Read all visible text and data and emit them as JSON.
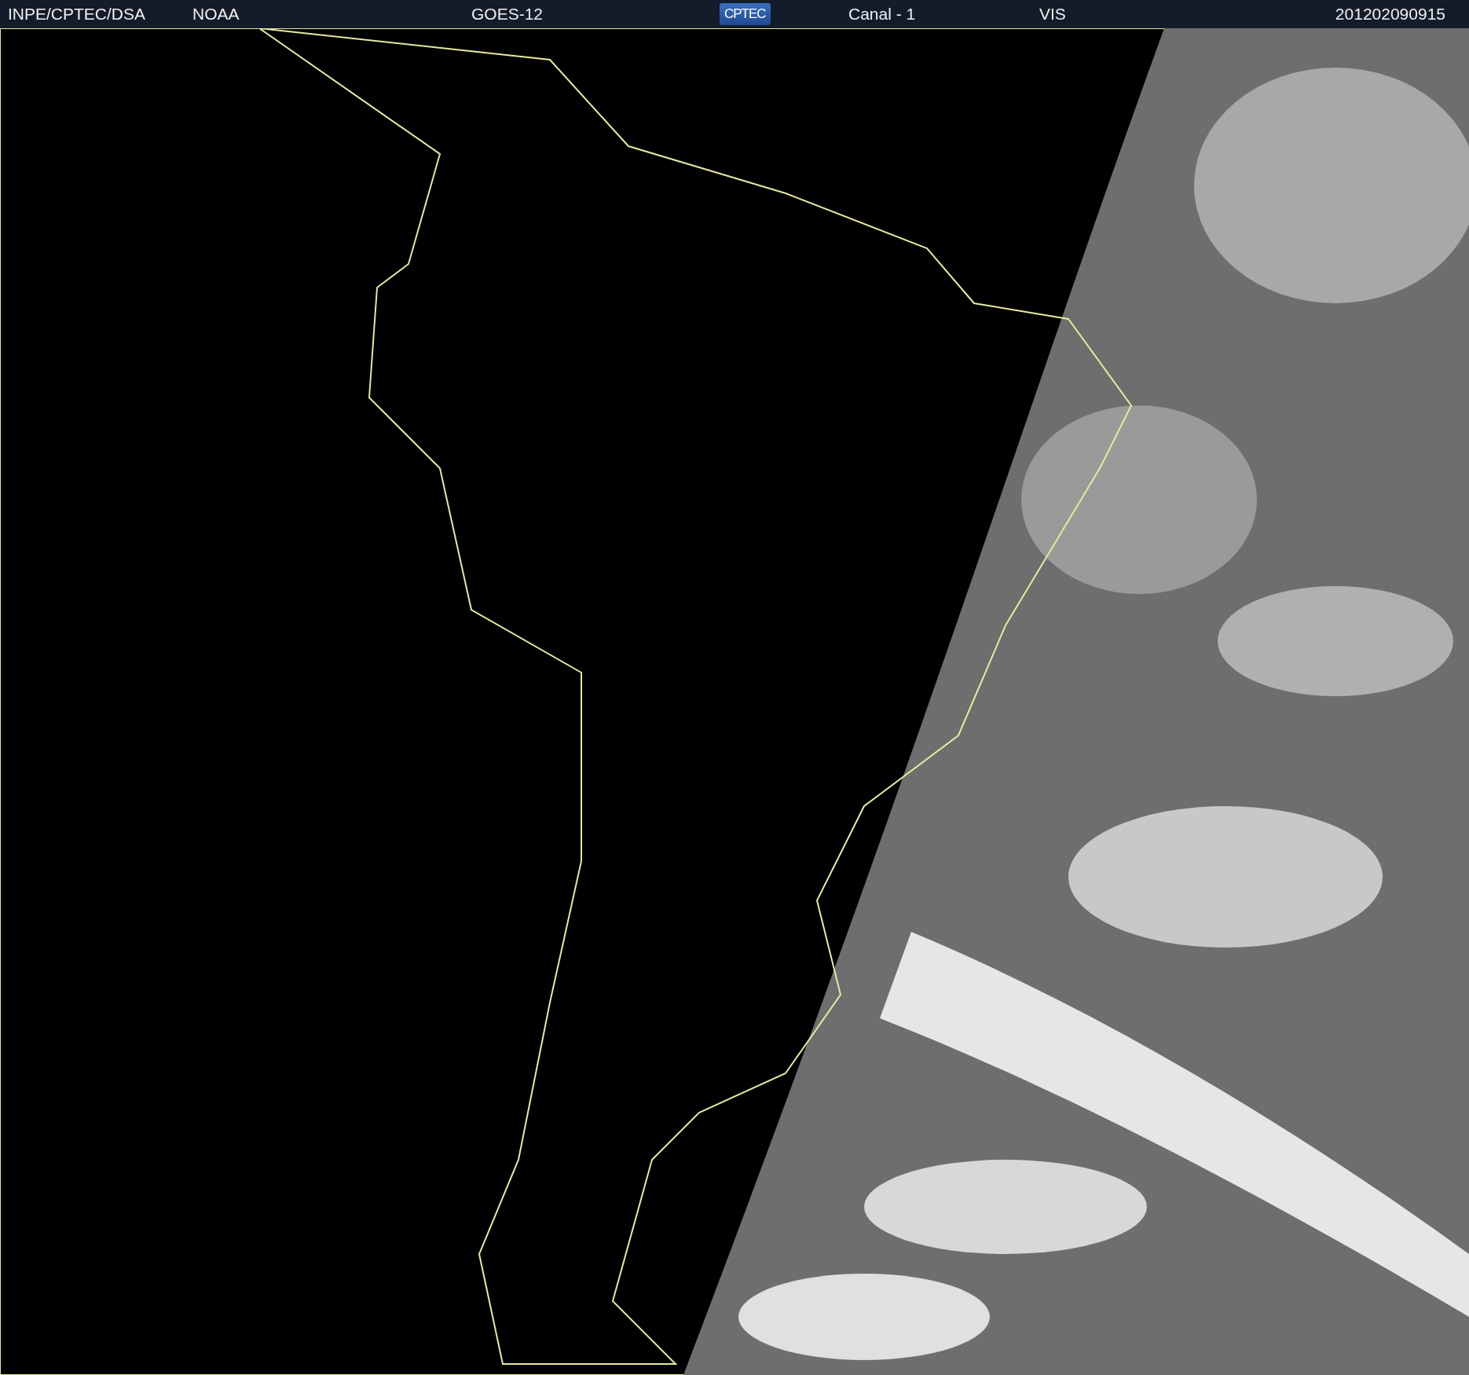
{
  "header": {
    "items": [
      {
        "kind": "text",
        "text": "INPE/CPTEC/DSA"
      },
      {
        "kind": "text",
        "text": "NOAA"
      },
      {
        "kind": "text",
        "text": "GOES-12"
      },
      {
        "kind": "logo",
        "text": "CPTEC"
      },
      {
        "kind": "text",
        "text": "Canal - 1"
      },
      {
        "kind": "text",
        "text": "VIS"
      },
      {
        "kind": "text",
        "text": "201202090915"
      }
    ]
  }
}
